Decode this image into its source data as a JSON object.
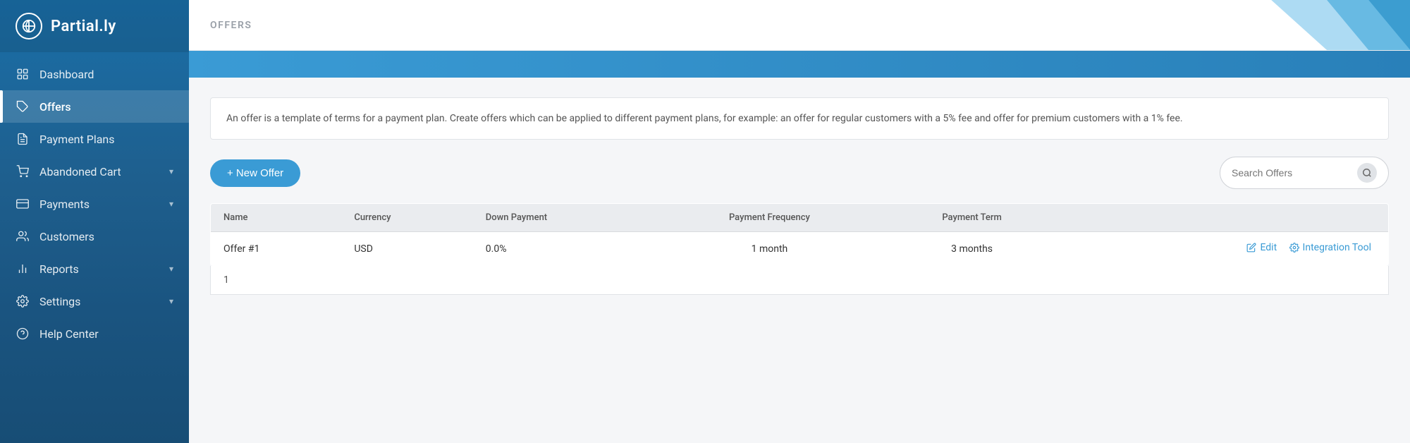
{
  "app": {
    "name": "Partial.ly"
  },
  "sidebar": {
    "items": [
      {
        "id": "dashboard",
        "label": "Dashboard",
        "icon": "grid"
      },
      {
        "id": "offers",
        "label": "Offers",
        "icon": "tag",
        "active": true
      },
      {
        "id": "payment-plans",
        "label": "Payment Plans",
        "icon": "file-text"
      },
      {
        "id": "abandoned-cart",
        "label": "Abandoned Cart",
        "icon": "shopping-cart",
        "hasChevron": true
      },
      {
        "id": "payments",
        "label": "Payments",
        "icon": "credit-card",
        "hasChevron": true
      },
      {
        "id": "customers",
        "label": "Customers",
        "icon": "users"
      },
      {
        "id": "reports",
        "label": "Reports",
        "icon": "bar-chart",
        "hasChevron": true
      },
      {
        "id": "settings",
        "label": "Settings",
        "icon": "settings",
        "hasChevron": true
      },
      {
        "id": "help-center",
        "label": "Help Center",
        "icon": "help-circle"
      }
    ]
  },
  "page": {
    "title": "OFFERS",
    "info_text": "An offer is a template of terms for a payment plan. Create offers which can be applied to different payment plans, for example: an offer for regular customers with a 5% fee and offer for premium customers with a 1% fee.",
    "new_offer_label": "+ New Offer",
    "search_placeholder": "Search Offers"
  },
  "table": {
    "columns": [
      {
        "id": "name",
        "label": "Name"
      },
      {
        "id": "currency",
        "label": "Currency"
      },
      {
        "id": "down-payment",
        "label": "Down Payment"
      },
      {
        "id": "payment-frequency",
        "label": "Payment Frequency"
      },
      {
        "id": "payment-term",
        "label": "Payment Term"
      },
      {
        "id": "actions",
        "label": ""
      }
    ],
    "rows": [
      {
        "name": "Offer #1",
        "currency": "USD",
        "down_payment": "0.0%",
        "payment_frequency": "1 month",
        "payment_term": "3 months",
        "edit_label": "Edit",
        "integration_label": "Integration Tool"
      }
    ]
  },
  "pagination": {
    "current_page": "1"
  }
}
